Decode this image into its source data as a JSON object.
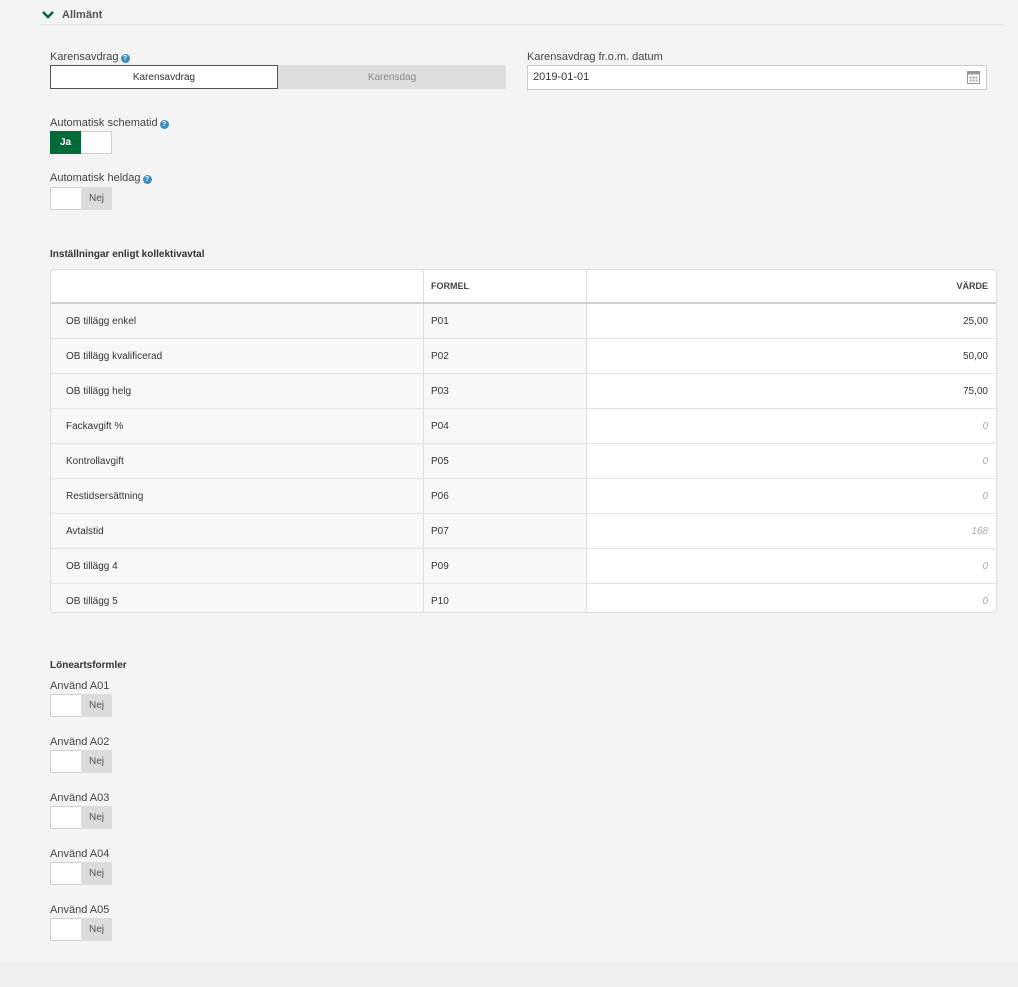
{
  "section": {
    "title": "Allmänt",
    "icon": "chevron-down-icon"
  },
  "karensavdrag": {
    "label": "Karensavdrag",
    "options": [
      "Karensavdrag",
      "Karensdag"
    ],
    "selected": "Karensavdrag"
  },
  "karens_date": {
    "label": "Karensavdrag fr.o.m. datum",
    "value": "2019-01-01"
  },
  "auto_schematid": {
    "label": "Automatisk schematid",
    "value_label": "Ja",
    "on": true
  },
  "auto_heldag": {
    "label": "Automatisk heldag",
    "value_label": "Nej",
    "on": false
  },
  "kollektivavtal": {
    "title": "Inställningar enligt kollektivavtal",
    "columns": [
      "",
      "FORMEL",
      "VÄRDE"
    ],
    "rows": [
      {
        "name": "OB tillägg enkel",
        "formula": "P01",
        "value": "25,00",
        "placeholder": ""
      },
      {
        "name": "OB tillägg kvalificerad",
        "formula": "P02",
        "value": "50,00",
        "placeholder": ""
      },
      {
        "name": "OB tillägg helg",
        "formula": "P03",
        "value": "75,00",
        "placeholder": ""
      },
      {
        "name": "Fackavgift %",
        "formula": "P04",
        "value": "",
        "placeholder": "0"
      },
      {
        "name": "Kontrollavgift",
        "formula": "P05",
        "value": "",
        "placeholder": "0"
      },
      {
        "name": "Restidsersättning",
        "formula": "P06",
        "value": "",
        "placeholder": "0"
      },
      {
        "name": "Avtalstid",
        "formula": "P07",
        "value": "",
        "placeholder": "168"
      },
      {
        "name": "OB tillägg 4",
        "formula": "P09",
        "value": "",
        "placeholder": "0"
      },
      {
        "name": "OB tillägg 5",
        "formula": "P10",
        "value": "",
        "placeholder": "0"
      }
    ]
  },
  "loneartsformler": {
    "title": "Löneartsformler",
    "items": [
      {
        "label": "Använd A01",
        "value_label": "Nej"
      },
      {
        "label": "Använd A02",
        "value_label": "Nej"
      },
      {
        "label": "Använd A03",
        "value_label": "Nej"
      },
      {
        "label": "Använd A04",
        "value_label": "Nej"
      },
      {
        "label": "Använd A05",
        "value_label": "Nej"
      }
    ]
  },
  "colors": {
    "accent_green": "#006b36",
    "help_blue": "#3c8dbc"
  }
}
